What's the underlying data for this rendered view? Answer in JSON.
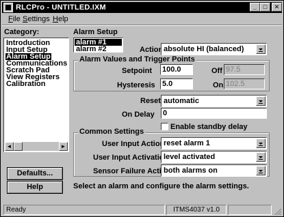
{
  "window": {
    "title": "RLCPro - UNTITLED.IXM",
    "minimize": "_",
    "maximize": "□",
    "close": "✕"
  },
  "menu": [
    {
      "underline": "F",
      "rest": "ile"
    },
    {
      "underline": "S",
      "rest": "ettings"
    },
    {
      "underline": "H",
      "rest": "elp"
    }
  ],
  "category": {
    "label": "Category:",
    "items": [
      "Introduction",
      "Input Setup",
      "Alarm Setup",
      "Communications",
      "Scratch Pad",
      "View Registers",
      "Calibration"
    ],
    "selected_index": 2,
    "scroll_left": "◄",
    "scroll_right": "►"
  },
  "buttons": {
    "defaults": "Defaults...",
    "help": "Help"
  },
  "alarm_setup": {
    "heading": "Alarm Setup",
    "alarms": [
      "alarm #1",
      "alarm #2"
    ],
    "selected_alarm": 0,
    "action_label": "Action",
    "action_value": "absolute HI (balanced)",
    "values_group": "Alarm Values and Trigger Points",
    "setpoint_label": "Setpoint",
    "setpoint_value": "100.0",
    "off_label": "Off",
    "off_value": "97.5",
    "hysteresis_label": "Hysteresis",
    "hysteresis_value": "5.0",
    "on_label": "On",
    "on_value": "102.5",
    "reset_label": "Reset",
    "reset_value": "automatic",
    "ondelay_label": "On Delay",
    "ondelay_value": "0",
    "standby_label": "Enable standby delay",
    "standby_checked": false,
    "common_group": "Common Settings",
    "user_input_action_label": "User Input Action",
    "user_input_action_value": "reset alarm 1",
    "user_input_activation_label": "User Input Activation",
    "user_input_activation_value": "level activated",
    "sensor_failure_label": "Sensor Failure Action",
    "sensor_failure_value": "both alarms on",
    "hint": "Select an alarm and configure the alarm settings."
  },
  "status": {
    "left": "Ready",
    "middle": "ITMS4037 v1.0",
    "right": ""
  }
}
